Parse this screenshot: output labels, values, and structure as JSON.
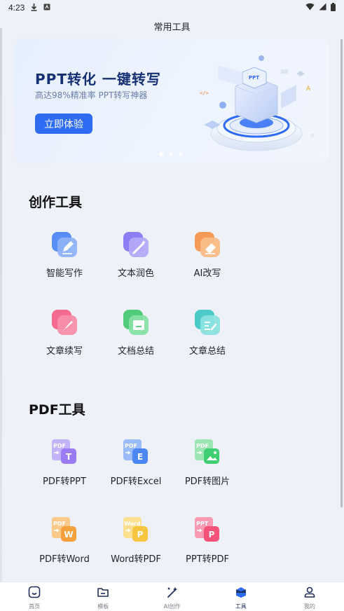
{
  "status": {
    "time": "4:23"
  },
  "header": {
    "title": "常用工具"
  },
  "banner": {
    "title": "PPT转化 一键转写",
    "subtitle": "高达98%精准率 PPT转写神器",
    "cta": "立即体验",
    "art_badge": "PPT",
    "page_count": 3,
    "active_index": 0
  },
  "sections": [
    {
      "title": "创作工具",
      "tools": [
        {
          "label": "智能写作",
          "icon": "pen-icon",
          "color": "#3d7cf5"
        },
        {
          "label": "文本润色",
          "icon": "magic-wand-icon",
          "color": "#7b6af5"
        },
        {
          "label": "AI改写",
          "icon": "eraser-icon",
          "color": "#f5893a"
        },
        {
          "label": "文章续写",
          "icon": "brush-icon",
          "color": "#f2527a"
        },
        {
          "label": "文档总结",
          "icon": "inbox-icon",
          "color": "#33c464"
        },
        {
          "label": "文章总结",
          "icon": "note-edit-icon",
          "color": "#2fc3c0"
        }
      ]
    },
    {
      "title": "PDF工具",
      "tools": [
        {
          "label": "PDF转PPT",
          "icon": "pdf-to-ppt-icon",
          "color": "#9b7cf5",
          "from": "PDF",
          "to": "T"
        },
        {
          "label": "PDF转Excel",
          "icon": "pdf-to-excel-icon",
          "color": "#4c86f5",
          "from": "PDF",
          "to": "E"
        },
        {
          "label": "PDF转图片",
          "icon": "pdf-to-image-icon",
          "color": "#3fcf72",
          "from": "PDF",
          "to": ""
        },
        {
          "label": "PDF转Word",
          "icon": "pdf-to-word-icon",
          "color": "#f7a13e",
          "from": "PDF",
          "to": "W"
        },
        {
          "label": "Word转PDF",
          "icon": "word-to-pdf-icon",
          "color": "#f7c640",
          "from": "Word",
          "to": "P"
        },
        {
          "label": "PPT转PDF",
          "icon": "ppt-to-pdf-icon",
          "color": "#f5527a",
          "from": "PPT",
          "to": "P"
        }
      ]
    }
  ],
  "tabbar": {
    "items": [
      {
        "label": "首页",
        "icon": "home-icon"
      },
      {
        "label": "模板",
        "icon": "folder-icon"
      },
      {
        "label": "AI创作",
        "icon": "magic-wand-icon"
      },
      {
        "label": "工具",
        "icon": "toolbox-icon"
      },
      {
        "label": "我的",
        "icon": "user-icon"
      }
    ],
    "active_index": 3
  }
}
